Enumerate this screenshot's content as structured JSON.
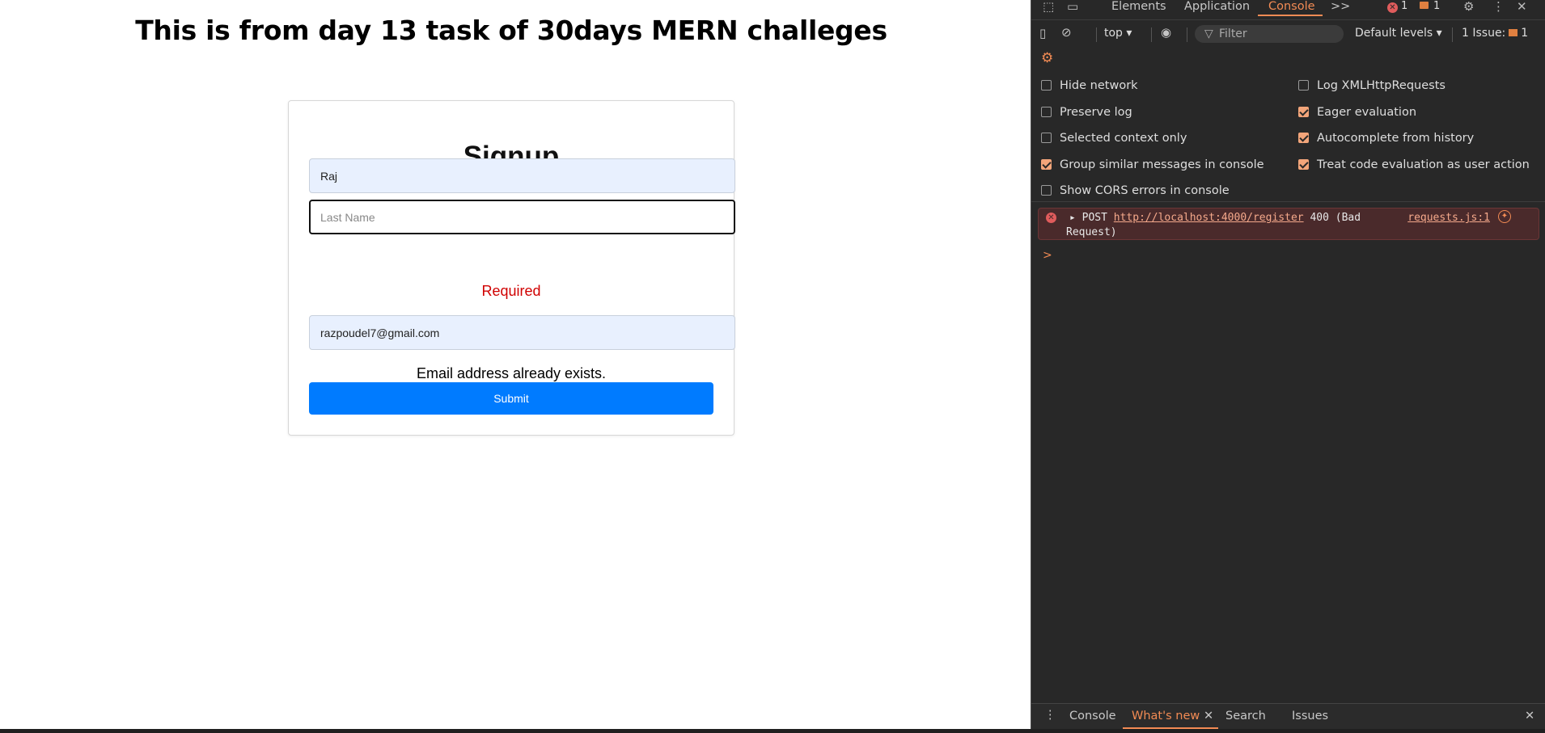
{
  "page": {
    "heading": "This is from day 13 task of 30days MERN challeges",
    "form": {
      "title": "Signup",
      "first_name_value": "Raj",
      "last_name_placeholder": "Last Name",
      "last_name_error": "Required",
      "email_value": "razpoudel7@gmail.com",
      "email_error": "Email address already exists.",
      "submit_label": "Submit"
    }
  },
  "devtools": {
    "tabs": [
      {
        "label": "Elements"
      },
      {
        "label": "Application"
      },
      {
        "label": "Console"
      }
    ],
    "more_tabs_icon": ">>",
    "error_count": "1",
    "message_count": "1",
    "toolbar": {
      "context": "top",
      "filter_placeholder": "Filter",
      "levels_label": "Default levels",
      "issues_label": "1 Issue:",
      "issues_count": "1"
    },
    "settings": [
      {
        "label": "Hide network",
        "checked": false
      },
      {
        "label": "Log XMLHttpRequests",
        "checked": false
      },
      {
        "label": "Preserve log",
        "checked": false
      },
      {
        "label": "Eager evaluation",
        "checked": true
      },
      {
        "label": "Selected context only",
        "checked": false
      },
      {
        "label": "Autocomplete from history",
        "checked": true
      },
      {
        "label": "Group similar messages in console",
        "checked": true
      },
      {
        "label": "Treat code evaluation as user action",
        "checked": true
      },
      {
        "label": "Show CORS errors in console",
        "checked": false
      }
    ],
    "console_error": {
      "method": "POST",
      "url": "http://localhost:4000/register",
      "status_part1": "400 (Bad",
      "status_part2": "Request)",
      "source": "requests.js:1"
    },
    "prompt": ">",
    "drawer_tabs": [
      {
        "label": "Console"
      },
      {
        "label": "What's new"
      },
      {
        "label": "Search"
      },
      {
        "label": "Issues"
      }
    ],
    "colors": {
      "accent": "#f28b54",
      "error_bg": "#4a2a2b",
      "submit_blue": "#007bff",
      "error_red": "#d00000"
    }
  }
}
